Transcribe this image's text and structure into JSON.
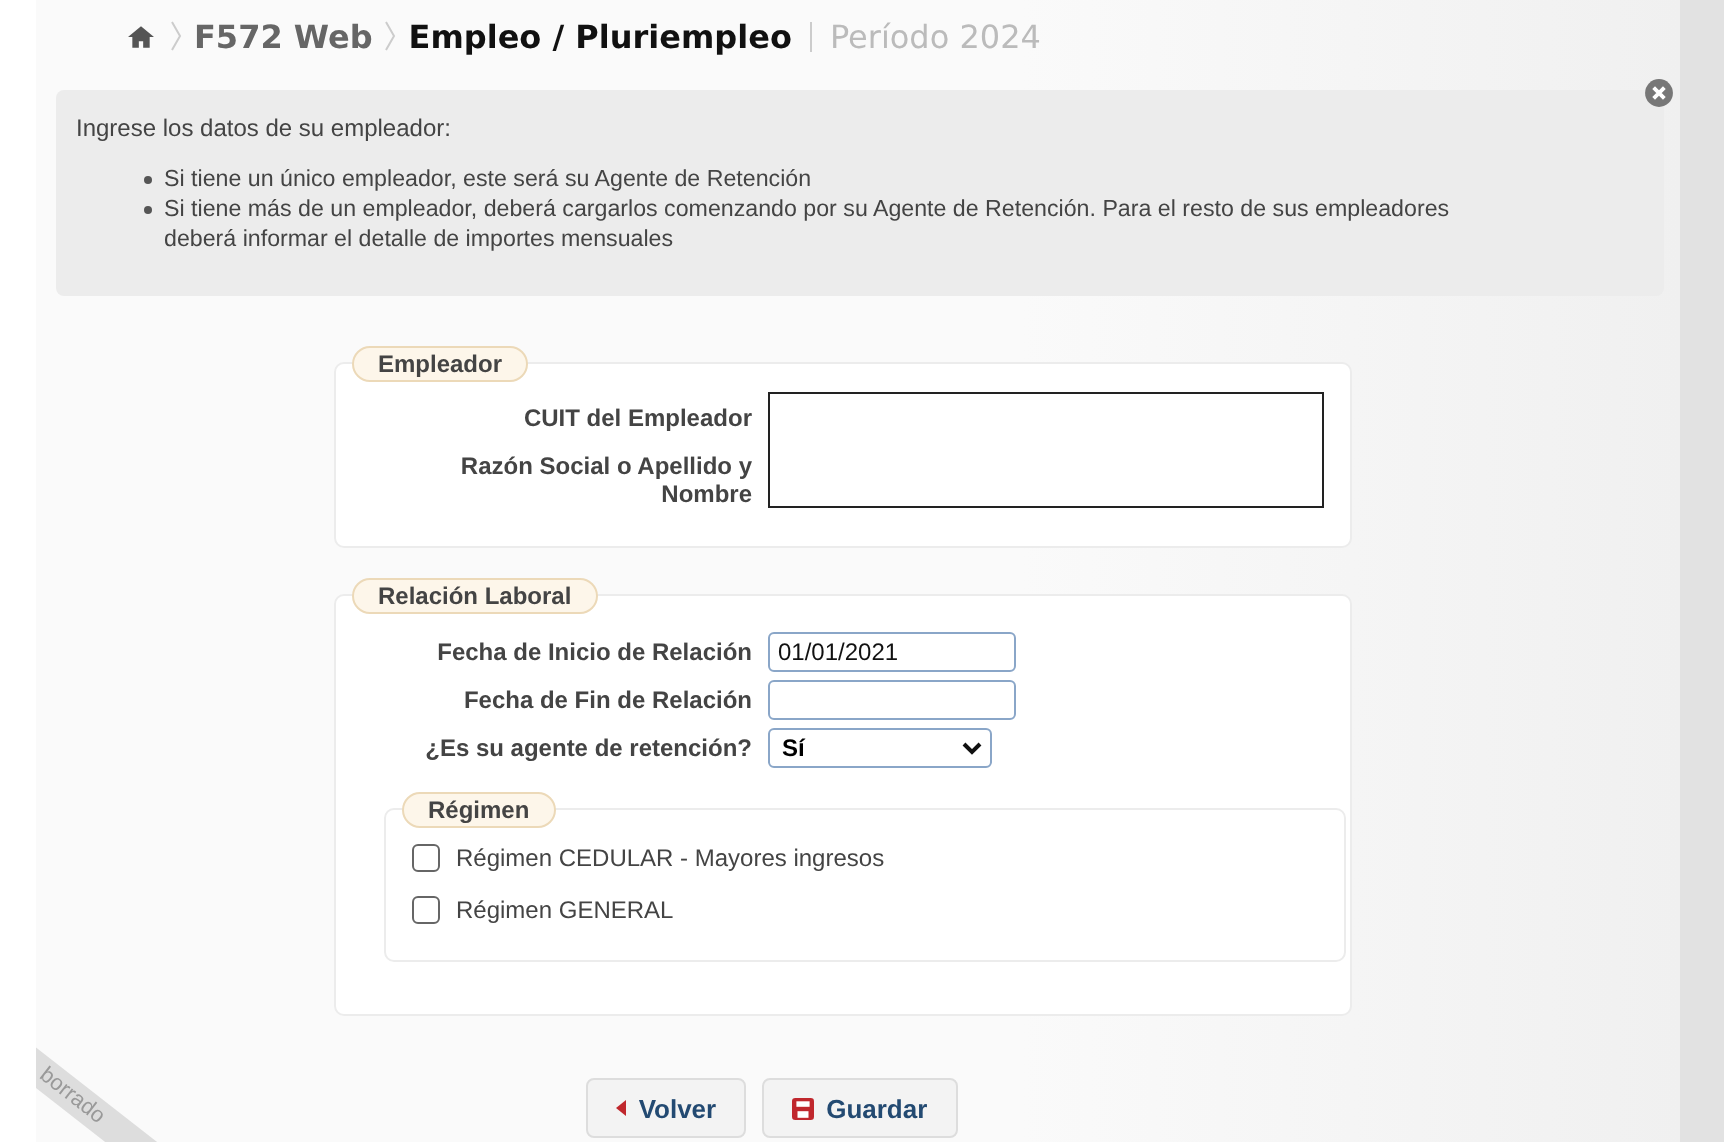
{
  "breadcrumb": {
    "items": [
      "F572 Web",
      "Empleo / Pluriempleo"
    ],
    "period": "Período 2024"
  },
  "info": {
    "intro": "Ingrese los datos de su empleador:",
    "bullets": [
      "Si tiene un único empleador, este será su Agente de Retención",
      "Si tiene más de un empleador, deberá cargarlos comenzando por su Agente de Retención. Para el resto de sus empleadores deberá informar el detalle de importes mensuales"
    ]
  },
  "employer": {
    "legend": "Empleador",
    "labels": [
      "CUIT del Empleador",
      "Razón Social o Apellido y Nombre"
    ]
  },
  "relation": {
    "legend": "Relación Laboral",
    "fields": [
      {
        "kind": "input",
        "label": "Fecha de Inicio de Relación",
        "value": "01/01/2021"
      },
      {
        "kind": "input",
        "label": "Fecha de Fin de Relación"
      },
      {
        "kind": "select",
        "label": "¿Es su agente de retención?",
        "value": "Sí"
      }
    ],
    "regime": {
      "legend": "Régimen",
      "options": [
        {
          "label": "Régimen CEDULAR - Mayores ingresos",
          "checked": false
        },
        {
          "label": "Régimen GENERAL",
          "checked": false
        }
      ]
    }
  },
  "buttons": [
    {
      "kind": "back",
      "label": "Volver"
    },
    {
      "kind": "save",
      "label": "Guardar"
    }
  ],
  "ribbon": "borrado"
}
